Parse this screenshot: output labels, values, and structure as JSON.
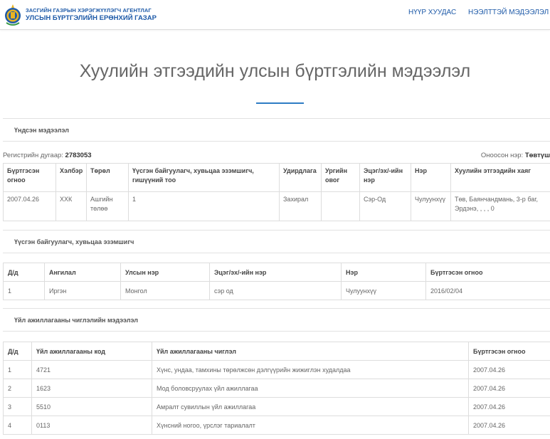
{
  "header": {
    "agency_line1": "ЗАСГИЙН ГАЗРЫН ХЭРЭГЖҮҮЛЭГЧ АГЕНТЛАГ",
    "agency_line2": "УЛСЫН БҮРТГЭЛИЙН ЕРӨНХИЙ ГАЗАР",
    "nav_home": "НҮҮР ХУУДАС",
    "nav_info": "НЭЭЛТТЭЙ МЭДЭЭЛЭЛ"
  },
  "page_title": "Хуулийн этгээдийн улсын бүртгэлийн мэдээлэл",
  "basic": {
    "section_title": "Үндсэн мэдээлэл",
    "reg_label": "Регистрийн дугаар:",
    "reg_value": "2783053",
    "alt_label": "Оноосон нэр:",
    "alt_value": "Төвтүш",
    "headers": [
      "Бүртгэсэн огноо",
      "Хэлбэр",
      "Төрөл",
      "Үүсгэн байгуулагч, хувьцаа эзэмшигч, гишүүний тоо",
      "Удирдлага",
      "Ургийн овог",
      "Эцэг/эх/-ийн нэр",
      "Нэр",
      "Хуулийн этгээдийн хаяг"
    ],
    "row": [
      "2007.04.26",
      "ХХК",
      "Ашгийн төлөө",
      "1",
      "Захирал",
      "",
      "Сэр-Од",
      "Чулуунхүү",
      "Төв, Баянчандмань, 3-р баг, Эрдэнэ, , , , 0"
    ]
  },
  "founders": {
    "section_title": "Үүсгэн байгуулагч, хувьцаа эзэмшигч",
    "headers": [
      "Д/д",
      "Ангилал",
      "Улсын нэр",
      "Эцэг/эх/-ийн нэр",
      "Нэр",
      "Бүртгэсэн огноо"
    ],
    "rows": [
      [
        "1",
        "Иргэн",
        "Монгол",
        "сэр од",
        "Чулуунхүү",
        "2016/02/04"
      ]
    ]
  },
  "activities": {
    "section_title": "Үйл ажиллагааны чиглэлийн мэдээлэл",
    "headers": [
      "Д/д",
      "Үйл ажиллагааны код",
      "Үйл ажиллагааны чиглэл",
      "Бүртгэсэн огноо"
    ],
    "rows": [
      [
        "1",
        "4721",
        "Хүнс, ундаа, тамхины төрөлжсөн дэлгүүрийн жижиглэн худалдаа",
        "2007.04.26"
      ],
      [
        "2",
        "1623",
        "Мод боловсруулах үйл ажиллагаа",
        "2007.04.26"
      ],
      [
        "3",
        "5510",
        "Амралт сувиллын үйл ажиллагаа",
        "2007.04.26"
      ],
      [
        "4",
        "0113",
        "Хүнсний ногоо, үрслэг тариалалт",
        "2007.04.26"
      ]
    ]
  },
  "colors": {
    "accent": "#1e5aa8",
    "underline": "#2e7cc4",
    "emblem_gold": "#e8b322",
    "emblem_blue": "#1e5aa8"
  }
}
